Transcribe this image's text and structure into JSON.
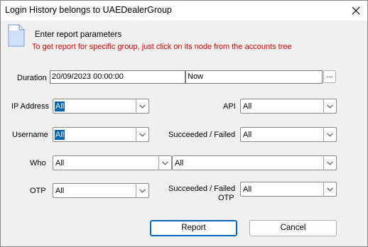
{
  "window": {
    "title": "Login History belongs to UAEDealerGroup"
  },
  "header": {
    "title": "Enter report parameters",
    "hint": "To get report for specific group, just click on its node from the accounts tree",
    "hint_color": "#e00000"
  },
  "duration": {
    "label": "Duration",
    "from": "20/09/2023 00:00:00",
    "to": "Now",
    "picker_label": "..."
  },
  "fields": {
    "ip_address": {
      "label": "IP Address",
      "value": "All"
    },
    "api": {
      "label": "API",
      "value": "All"
    },
    "username": {
      "label": "Username",
      "value": "All"
    },
    "succeeded_failed": {
      "label": "Succeeded / Failed",
      "value": "All"
    },
    "who": {
      "label": "Who",
      "value1": "All",
      "value2": "All"
    },
    "otp": {
      "label": "OTP",
      "value": "All"
    },
    "succeeded_failed_otp": {
      "label_line1": "Succeeded / Failed",
      "label_line2": "OTP",
      "value": "All"
    }
  },
  "buttons": {
    "report": "Report",
    "cancel": "Cancel"
  },
  "icons": {
    "close": "close-icon",
    "document": "document-icon",
    "dropdown": "chevron-down-icon"
  },
  "colors": {
    "selection": "#0063b1",
    "default_button_border": "#0067c0"
  }
}
